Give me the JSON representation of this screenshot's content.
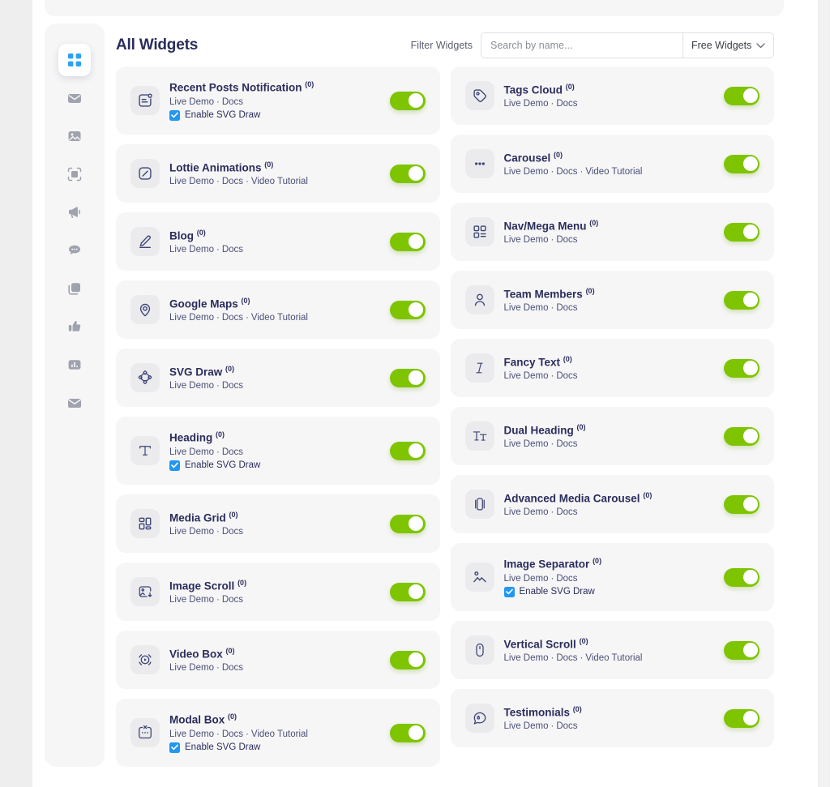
{
  "header": {
    "title": "All Widgets",
    "filter_label": "Filter Widgets",
    "search_placeholder": "Search by name...",
    "search_value": "",
    "select_value": "Free Widgets",
    "chevron_icon": "chevron-down-icon"
  },
  "colors": {
    "toggle_on": "#7ec400",
    "checkbox": "#2196f3",
    "title": "#2b2d5c",
    "card_bg": "#f6f6f7",
    "accent_blue": "#29a3f5"
  },
  "sidebar": {
    "items": [
      {
        "icon": "grid-icon",
        "active": true
      },
      {
        "icon": "envelope-icon",
        "active": false
      },
      {
        "icon": "image-icon",
        "active": false
      },
      {
        "icon": "frame-icon",
        "active": false
      },
      {
        "icon": "megaphone-icon",
        "active": false
      },
      {
        "icon": "chat-bubble-icon",
        "active": false
      },
      {
        "icon": "copy-icon",
        "active": false
      },
      {
        "icon": "thumbs-up-icon",
        "active": false
      },
      {
        "icon": "chart-bar-icon",
        "active": false
      },
      {
        "icon": "mail-icon",
        "active": false
      }
    ]
  },
  "labels": {
    "live_demo": "Live Demo",
    "docs": "Docs",
    "video_tutorial": "Video Tutorial",
    "separator": "·",
    "enable_svg_draw": "Enable SVG Draw",
    "count_suffix": "(0)"
  },
  "widgets_left": [
    {
      "name": "Recent Posts Notification",
      "count": "(0)",
      "icon": "recent-posts-icon",
      "links": [
        "Live Demo",
        "Docs"
      ],
      "svg_draw": true,
      "enabled": true
    },
    {
      "name": "Lottie Animations",
      "count": "(0)",
      "icon": "lottie-icon",
      "links": [
        "Live Demo",
        "Docs",
        "Video Tutorial"
      ],
      "svg_draw": false,
      "enabled": true
    },
    {
      "name": "Blog",
      "count": "(0)",
      "icon": "pencil-icon",
      "links": [
        "Live Demo",
        "Docs"
      ],
      "svg_draw": false,
      "enabled": true
    },
    {
      "name": "Google Maps",
      "count": "(0)",
      "icon": "map-pin-icon",
      "links": [
        "Live Demo",
        "Docs",
        "Video Tutorial"
      ],
      "svg_draw": false,
      "enabled": true
    },
    {
      "name": "SVG Draw",
      "count": "(0)",
      "icon": "svg-draw-icon",
      "links": [
        "Live Demo",
        "Docs"
      ],
      "svg_draw": false,
      "enabled": true
    },
    {
      "name": "Heading",
      "count": "(0)",
      "icon": "text-t-icon",
      "links": [
        "Live Demo",
        "Docs"
      ],
      "svg_draw": true,
      "enabled": true
    },
    {
      "name": "Media Grid",
      "count": "(0)",
      "icon": "media-grid-icon",
      "links": [
        "Live Demo",
        "Docs"
      ],
      "svg_draw": false,
      "enabled": true
    },
    {
      "name": "Image Scroll",
      "count": "(0)",
      "icon": "image-scroll-icon",
      "links": [
        "Live Demo",
        "Docs"
      ],
      "svg_draw": false,
      "enabled": true
    },
    {
      "name": "Video Box",
      "count": "(0)",
      "icon": "video-play-icon",
      "links": [
        "Live Demo",
        "Docs"
      ],
      "svg_draw": false,
      "enabled": true
    },
    {
      "name": "Modal Box",
      "count": "(0)",
      "icon": "modal-box-icon",
      "links": [
        "Live Demo",
        "Docs",
        "Video Tutorial"
      ],
      "svg_draw": true,
      "enabled": true
    }
  ],
  "widgets_right": [
    {
      "name": "Tags Cloud",
      "count": "(0)",
      "icon": "tag-icon",
      "links": [
        "Live Demo",
        "Docs"
      ],
      "svg_draw": false,
      "enabled": true
    },
    {
      "name": "Carousel",
      "count": "(0)",
      "icon": "dots-icon",
      "links": [
        "Live Demo",
        "Docs",
        "Video Tutorial"
      ],
      "svg_draw": false,
      "enabled": true
    },
    {
      "name": "Nav/Mega Menu",
      "count": "(0)",
      "icon": "nav-menu-icon",
      "links": [
        "Live Demo",
        "Docs"
      ],
      "svg_draw": false,
      "enabled": true
    },
    {
      "name": "Team Members",
      "count": "(0)",
      "icon": "person-icon",
      "links": [
        "Live Demo",
        "Docs"
      ],
      "svg_draw": false,
      "enabled": true
    },
    {
      "name": "Fancy Text",
      "count": "(0)",
      "icon": "italic-i-icon",
      "links": [
        "Live Demo",
        "Docs"
      ],
      "svg_draw": false,
      "enabled": true
    },
    {
      "name": "Dual Heading",
      "count": "(0)",
      "icon": "dual-text-icon",
      "links": [
        "Live Demo",
        "Docs"
      ],
      "svg_draw": false,
      "enabled": true
    },
    {
      "name": "Advanced Media Carousel",
      "count": "(0)",
      "icon": "media-carousel-icon",
      "links": [
        "Live Demo",
        "Docs"
      ],
      "svg_draw": false,
      "enabled": true
    },
    {
      "name": "Image Separator",
      "count": "(0)",
      "icon": "image-separator-icon",
      "links": [
        "Live Demo",
        "Docs"
      ],
      "svg_draw": true,
      "enabled": true
    },
    {
      "name": "Vertical Scroll",
      "count": "(0)",
      "icon": "mouse-scroll-icon",
      "links": [
        "Live Demo",
        "Docs",
        "Video Tutorial"
      ],
      "svg_draw": false,
      "enabled": true
    },
    {
      "name": "Testimonials",
      "count": "(0)",
      "icon": "quote-bubble-icon",
      "links": [
        "Live Demo",
        "Docs"
      ],
      "svg_draw": false,
      "enabled": true
    }
  ],
  "scrollbar": {
    "name": "page-scrollbar"
  }
}
